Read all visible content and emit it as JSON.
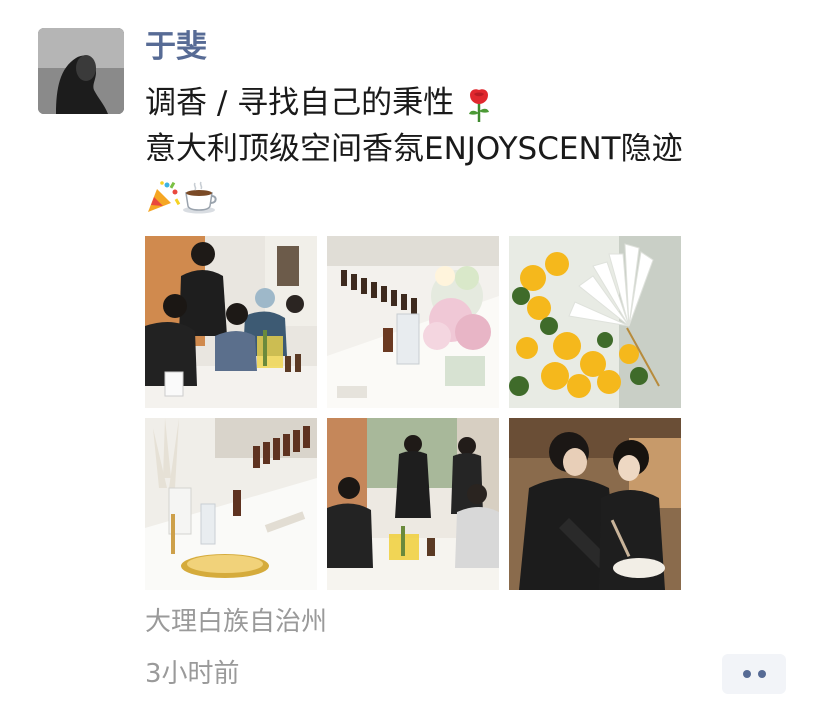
{
  "post": {
    "author": "于斐",
    "text_line1": "调香 / 寻找自己的秉性",
    "text_line2": "意大利顶级空间香氛ENJOYSCENT隐迹",
    "emojis": [
      "rose-icon",
      "party-popper-icon",
      "hot-beverage-icon"
    ],
    "photos": [
      {
        "icon": "photo-workshop-participants"
      },
      {
        "icon": "photo-perfume-bottles-flowers"
      },
      {
        "icon": "photo-yellow-flowers-paper-fan"
      },
      {
        "icon": "photo-table-bottles-gold-tray"
      },
      {
        "icon": "photo-group-standing-table"
      },
      {
        "icon": "photo-two-women-closeup"
      }
    ],
    "location": "大理白族自治州",
    "time": "3小时前"
  },
  "colors": {
    "name": "#576b95",
    "meta_text": "#9a9a9a",
    "more_button_bg": "#f2f4f8"
  }
}
